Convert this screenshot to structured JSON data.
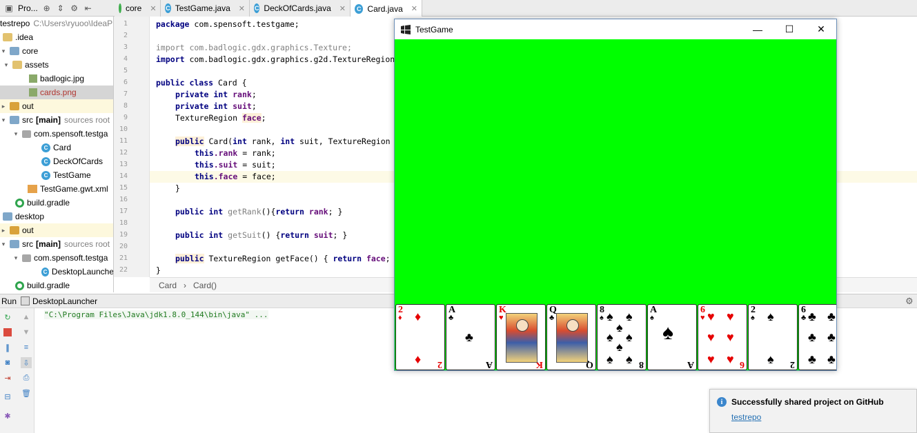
{
  "topbar": {
    "project_label": "Pro...",
    "tabs": [
      {
        "label": "core",
        "icon": "module-folder-icon",
        "active": false
      },
      {
        "label": "TestGame.java",
        "icon": "class-icon",
        "active": false
      },
      {
        "label": "DeckOfCards.java",
        "icon": "class-icon",
        "active": false
      },
      {
        "label": "Card.java",
        "icon": "class-icon",
        "active": true
      }
    ],
    "tab_letter": "C"
  },
  "project_tree": {
    "root": {
      "label": "testrepo",
      "path": "C:\\Users\\ryuoo\\IdeaP"
    },
    "items": [
      {
        "label": ".idea"
      },
      {
        "label": "core"
      },
      {
        "label": "assets"
      },
      {
        "label": "badlogic.jpg"
      },
      {
        "label": "cards.png"
      },
      {
        "label": "out"
      },
      {
        "label": "src",
        "bold": "[main]",
        "note": "sources root"
      },
      {
        "label": "com.spensoft.testga"
      },
      {
        "label": "Card"
      },
      {
        "label": "DeckOfCards"
      },
      {
        "label": "TestGame"
      },
      {
        "label": "TestGame.gwt.xml"
      },
      {
        "label": "build.gradle"
      },
      {
        "label": "desktop"
      },
      {
        "label": "out"
      },
      {
        "label": "src",
        "bold": "[main]",
        "note": "sources root"
      },
      {
        "label": "com.spensoft.testga"
      },
      {
        "label": "DesktopLaunche"
      },
      {
        "label": "build.gradle"
      }
    ]
  },
  "editor": {
    "line_numbers": [
      "1",
      "2",
      "3",
      "4",
      "5",
      "6",
      "7",
      "8",
      "9",
      "10",
      "11",
      "12",
      "13",
      "14",
      "15",
      "16",
      "17",
      "18",
      "19",
      "20",
      "21",
      "22"
    ],
    "lines": {
      "l1_kw": "package",
      "l1_rest": " com.spensoft.testgame;",
      "l3": "import com.badlogic.gdx.graphics.Texture;",
      "l4_kw": "import",
      "l4_rest": " com.badlogic.gdx.graphics.g2d.TextureRegion",
      "l6_kw": "public class",
      "l6_rest": " Card {",
      "l7_kw": "private int",
      "l7_f": "rank",
      "l7_end": ";",
      "l8_kw": "private int",
      "l8_f": "suit",
      "l8_end": ";",
      "l9_a": "TextureRegion ",
      "l9_f": "face",
      "l9_end": ";",
      "l11_kw": "public",
      "l11_rest": " Card(",
      "l11_kw2": "int",
      "l11_r2": " rank, ",
      "l11_kw3": "int",
      "l11_r3": " suit, TextureRegion",
      "l12_kw": "this",
      "l12_f": ".rank",
      "l12_rest": " = rank;",
      "l13_kw": "this",
      "l13_f": ".suit",
      "l13_rest": " = suit;",
      "l14_kw": "this",
      "l14_f": ".face",
      "l14_rest": " = face;",
      "l15": "}",
      "l17_kw": "public int",
      "l17_fn": " getRank",
      "l17_r": "(){",
      "l17_kw2": "return",
      "l17_f": " rank",
      "l17_end": "; }",
      "l19_kw": "public int",
      "l19_fn": " getSuit",
      "l19_r": "() {",
      "l19_kw2": "return",
      "l19_f": " suit",
      "l19_end": "; }",
      "l21_kw": "public",
      "l21_rest": " TextureRegion getFace() { ",
      "l21_kw2": "return",
      "l21_f": " face",
      "l21_end": ";",
      "l22": "}"
    }
  },
  "breadcrumb": {
    "items": [
      "Card",
      "Card()"
    ],
    "separator": "›"
  },
  "run_panel": {
    "title": "Run",
    "config": "DesktopLauncher",
    "console_line": "\"C:\\Program Files\\Java\\jdk1.8.0_144\\bin\\java\" ..."
  },
  "game_window": {
    "title": "TestGame",
    "minimize": "—",
    "maximize": "☐",
    "close": "✕",
    "background_color": "#00ff00",
    "cards": [
      {
        "rank": "2",
        "suit": "♦",
        "color": "red",
        "face": false
      },
      {
        "rank": "A",
        "suit": "♣",
        "color": "black",
        "face": false
      },
      {
        "rank": "K",
        "suit": "♥",
        "color": "red",
        "face": true
      },
      {
        "rank": "Q",
        "suit": "♣",
        "color": "black",
        "face": true
      },
      {
        "rank": "8",
        "suit": "♠",
        "color": "black",
        "face": false
      },
      {
        "rank": "A",
        "suit": "♠",
        "color": "black",
        "face": false
      },
      {
        "rank": "6",
        "suit": "♥",
        "color": "red",
        "face": false
      },
      {
        "rank": "2",
        "suit": "♠",
        "color": "black",
        "face": false
      },
      {
        "rank": "6",
        "suit": "♣",
        "color": "black",
        "face": false
      }
    ]
  },
  "notification": {
    "message": "Successfully shared project on GitHub",
    "link": "testrepo",
    "info_glyph": "i"
  }
}
